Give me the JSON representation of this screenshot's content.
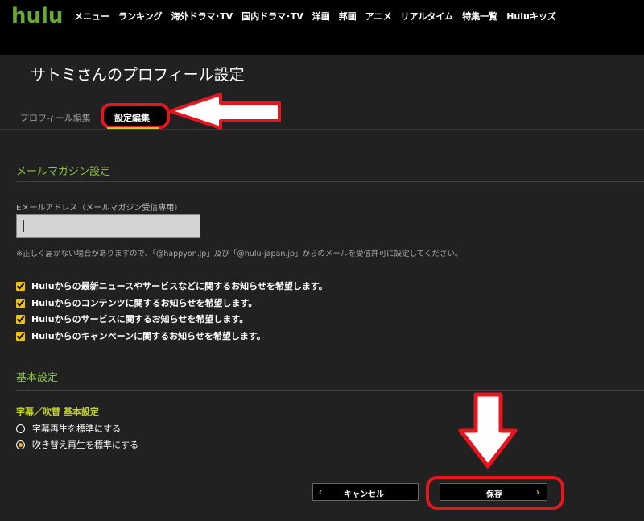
{
  "header": {
    "logo": "hulu",
    "nav": [
      "メニュー",
      "ランキング",
      "海外ドラマ･TV",
      "国内ドラマ･TV",
      "洋画",
      "邦画",
      "アニメ",
      "リアルタイム",
      "特集一覧",
      "Huluキッズ"
    ]
  },
  "page": {
    "title": "サトミさんのプロフィール設定"
  },
  "tabs": {
    "profile_edit": "プロフィール編集",
    "settings_edit": "設定編集",
    "active": "設定編集"
  },
  "mail_section": {
    "heading": "メールマガジン設定",
    "email_label": "Eメールアドレス（メールマガジン受信専用）",
    "email_value": "",
    "note": "※正しく届かない場合がありますので、「@happyon.jp」及び「@hulu-japan.jp」からのメールを受信許可に設定してください。",
    "options": [
      {
        "label": "Huluからの最新ニュースやサービスなどに関するお知らせを希望します。",
        "checked": true
      },
      {
        "label": "Huluからのコンテンツに関するお知らせを希望します。",
        "checked": true
      },
      {
        "label": "Huluからのサービスに関するお知らせを希望します。",
        "checked": true
      },
      {
        "label": "Huluからのキャンペーンに関するお知らせを希望します。",
        "checked": true
      }
    ]
  },
  "basic_section": {
    "heading": "基本設定",
    "subheading": "字幕／吹替 基本設定",
    "radios": [
      {
        "label": "字幕再生を標準にする",
        "selected": false
      },
      {
        "label": "吹き替え再生を標準にする",
        "selected": true
      }
    ]
  },
  "buttons": {
    "cancel": "キャンセル",
    "save": "保存",
    "cancel_chevron": "‹",
    "save_chevron": "›"
  },
  "colors": {
    "brand": "#66aa33",
    "accent_green": "#8cc63f",
    "checkbox_yellow": "#f2c200",
    "highlight_red": "#e8141e"
  }
}
